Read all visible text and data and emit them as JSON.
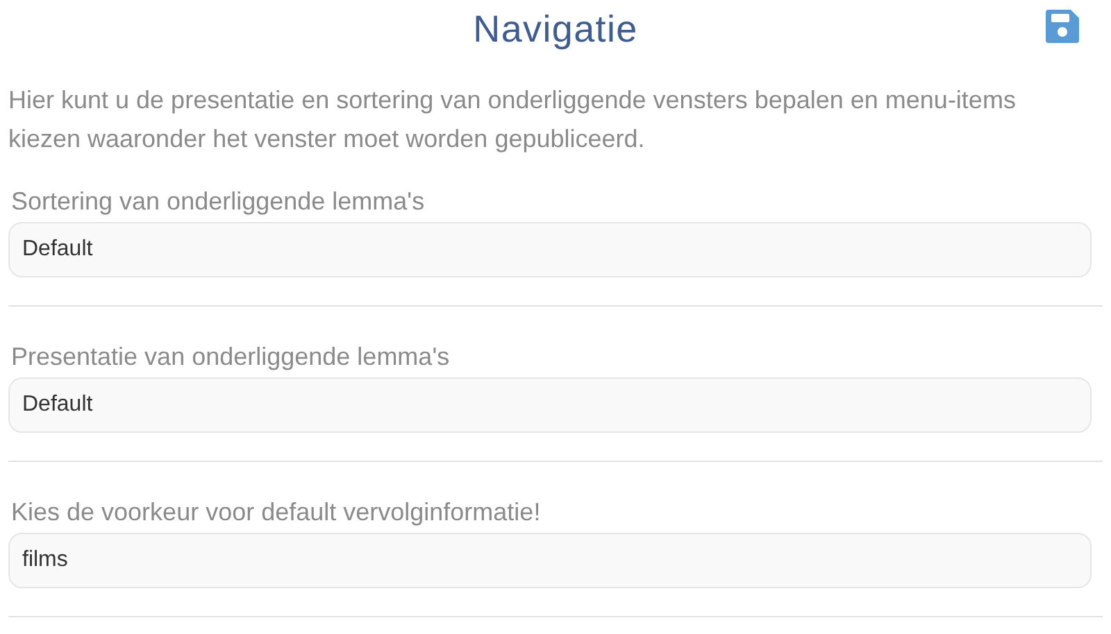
{
  "title": "Navigatie",
  "description": "Hier kunt u de presentatie en sortering van onderliggende vensters bepalen en menu-items kiezen waaronder het venster moet worden gepubliceerd.",
  "fields": [
    {
      "label": "Sortering van onderliggende lemma's",
      "value": "Default"
    },
    {
      "label": "Presentatie van onderliggende lemma's",
      "value": "Default"
    },
    {
      "label": "Kies de voorkeur voor default vervolginformatie!",
      "value": "films"
    }
  ]
}
